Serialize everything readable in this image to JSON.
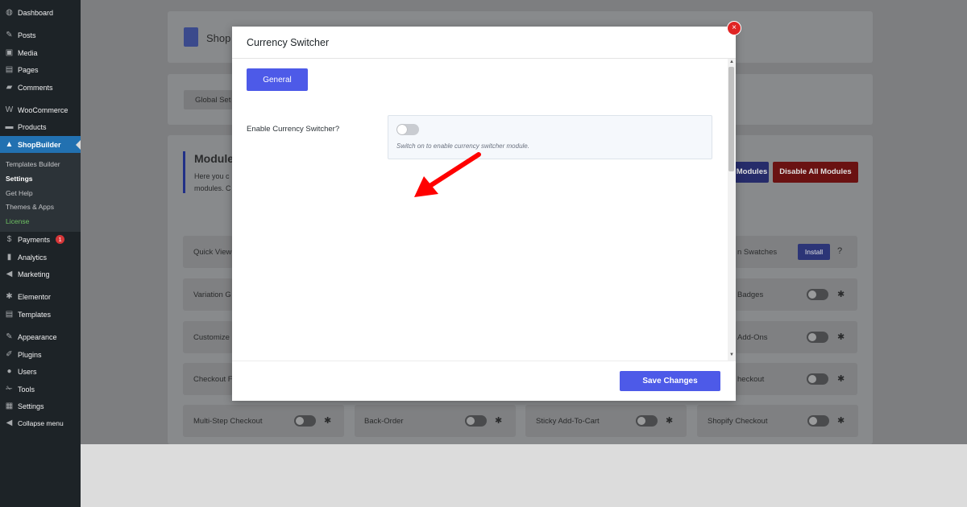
{
  "sidebar": {
    "menu": [
      {
        "label": "Dashboard",
        "icon": "dashboard-icon",
        "glyph": "◍"
      },
      {
        "label": "Posts",
        "icon": "pin-icon",
        "glyph": "✎"
      },
      {
        "label": "Media",
        "icon": "media-icon",
        "glyph": "▣"
      },
      {
        "label": "Pages",
        "icon": "pages-icon",
        "glyph": "▤"
      },
      {
        "label": "Comments",
        "icon": "comment-icon",
        "glyph": "▰"
      },
      {
        "label": "WooCommerce",
        "icon": "woo-icon",
        "glyph": "W"
      },
      {
        "label": "Products",
        "icon": "products-icon",
        "glyph": "▬"
      },
      {
        "label": "ShopBuilder",
        "icon": "bag-icon",
        "glyph": "▲"
      },
      {
        "label": "Payments",
        "icon": "payments-icon",
        "glyph": "$",
        "badge": "1"
      },
      {
        "label": "Analytics",
        "icon": "analytics-icon",
        "glyph": "▮"
      },
      {
        "label": "Marketing",
        "icon": "megaphone-icon",
        "glyph": "◀"
      },
      {
        "label": "Elementor",
        "icon": "elementor-icon",
        "glyph": "✱"
      },
      {
        "label": "Templates",
        "icon": "templates-icon",
        "glyph": "▤"
      },
      {
        "label": "Appearance",
        "icon": "brush-icon",
        "glyph": "✎"
      },
      {
        "label": "Plugins",
        "icon": "plug-icon",
        "glyph": "✐"
      },
      {
        "label": "Users",
        "icon": "user-icon",
        "glyph": "●"
      },
      {
        "label": "Tools",
        "icon": "wrench-icon",
        "glyph": "✁"
      },
      {
        "label": "Settings",
        "icon": "settings-icon",
        "glyph": "▦"
      },
      {
        "label": "Collapse menu",
        "icon": "collapse-icon",
        "glyph": "◀"
      }
    ],
    "submenu": [
      "Templates Builder",
      "Settings",
      "Get Help",
      "Themes & Apps",
      "License"
    ]
  },
  "background": {
    "logo_text": "Shop",
    "tab_label": "Global Set",
    "section_title": "Module",
    "section_desc_1": "Here you c",
    "section_desc_2": "modules. C",
    "enable_all_label": "Modules",
    "disable_all_label": "Disable All Modules",
    "modules_left": [
      "Quick View",
      "Variation G",
      "Customize",
      "Checkout F"
    ],
    "modules_right": [
      "n Swatches",
      "Badges",
      "Add-Ons",
      "heckout"
    ],
    "install_label": "Install",
    "bottom_modules": [
      "Multi-Step Checkout",
      "Back-Order",
      "Sticky Add-To-Cart",
      "Shopify Checkout"
    ]
  },
  "modal": {
    "title": "Currency Switcher",
    "tab_label": "General",
    "field_label": "Enable Currency Switcher?",
    "switch_on": false,
    "help_text": "Switch on to enable currency switcher module.",
    "save_label": "Save Changes",
    "close_glyph": "×"
  },
  "colors": {
    "accent": "#4d5ae8",
    "danger": "#e02424",
    "wp_active": "#2271b1",
    "arrow": "#ff0000"
  }
}
